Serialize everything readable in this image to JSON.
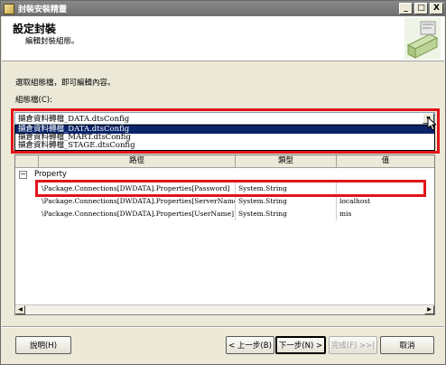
{
  "window": {
    "title": "封裝安裝精靈"
  },
  "titlebar_buttons": {
    "minimize": "_",
    "maximize": "□",
    "close": "X"
  },
  "header": {
    "title": "設定封裝",
    "subtitle": "編輯封裝組態。"
  },
  "instruction": "選取組態檔，即可編輯內容。",
  "config_label": "組態檔(C):",
  "config_combo": {
    "value": "擷倉資料轉檔_DATA.dtsConfig",
    "options": [
      {
        "label": "擷倉資料轉檔_DATA.dtsConfig",
        "selected": true
      },
      {
        "label": "擷倉資料轉檔_MART.dtsConfig",
        "selected": false
      },
      {
        "label": "擷倉資料轉檔_STAGE.dtsConfig",
        "selected": false
      }
    ]
  },
  "grid": {
    "columns": [
      "路徑",
      "類型",
      "值"
    ],
    "group": "Property",
    "rows": [
      {
        "path": "\\Package.Connections[DWDATA].Properties[Password]",
        "type": "System.String",
        "value": ""
      },
      {
        "path": "\\Package.Connections[DWDATA].Properties[ServerName]",
        "type": "System.String",
        "value": "localhost"
      },
      {
        "path": "\\Package.Connections[DWDATA].Properties[UserName]",
        "type": "System.String",
        "value": "mis"
      }
    ]
  },
  "buttons": {
    "help": "說明(H)",
    "back": "< 上一步(B)",
    "next": "下一步(N) >",
    "finish": "完成(F) >>|",
    "cancel": "取消"
  },
  "colors": {
    "highlight": "#e0141a",
    "selection": "#0a246a"
  }
}
